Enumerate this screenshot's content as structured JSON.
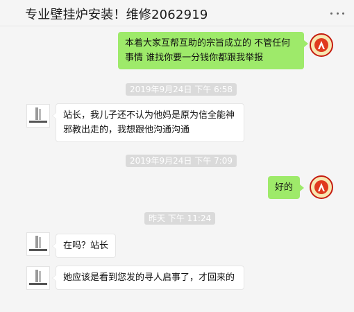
{
  "header": {
    "title": "专业壁挂炉安装！维修2062919"
  },
  "messages": [
    {
      "type": "outgoing",
      "text": "本着大家互帮互助的宗旨成立的  不管任何事情   谁找你要一分钱你都跟我举报"
    },
    {
      "type": "timestamp",
      "text": "2019年9月24日 下午 6:58"
    },
    {
      "type": "incoming",
      "text": "站长，我儿子还不认为他妈是原为信全能神邪教出走的，我想跟他沟通沟通"
    },
    {
      "type": "timestamp",
      "text": "2019年9月24日 下午 7:09"
    },
    {
      "type": "outgoing",
      "text": "好的"
    },
    {
      "type": "timestamp",
      "text": "昨天 下午 11:24"
    },
    {
      "type": "incoming",
      "text": "在吗？站长"
    },
    {
      "type": "incoming",
      "text": "她应该是看到您发的寻人启事了，才回来的"
    }
  ],
  "colors": {
    "outgoing_bubble": "#9eea6a",
    "incoming_bubble": "#ffffff",
    "timestamp_bg": "#dadada"
  }
}
